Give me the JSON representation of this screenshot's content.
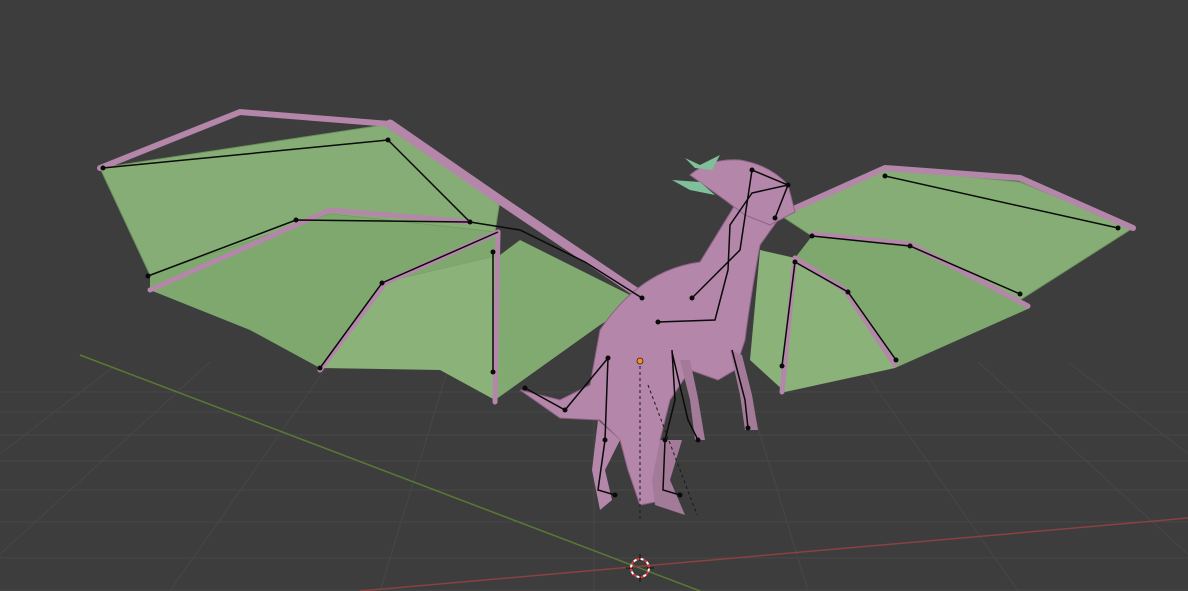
{
  "viewport": {
    "label": "",
    "background": "#3d3d3d",
    "grid_color": "#474747",
    "x_axis_color": "#8a4141",
    "y_axis_color": "#587a33"
  },
  "model": {
    "body_color": "#b486a9",
    "body_shadow": "#8f6487",
    "wing_membrane_color": "#86ad75",
    "wing_membrane_shadow": "#6b935c",
    "horn_color": "#7fbf9a",
    "bone_color": "#0a0a0a"
  },
  "origin_marker_color": "#ff8c1a",
  "cursor_colors": [
    "#ffffff",
    "#d63a3a"
  ]
}
